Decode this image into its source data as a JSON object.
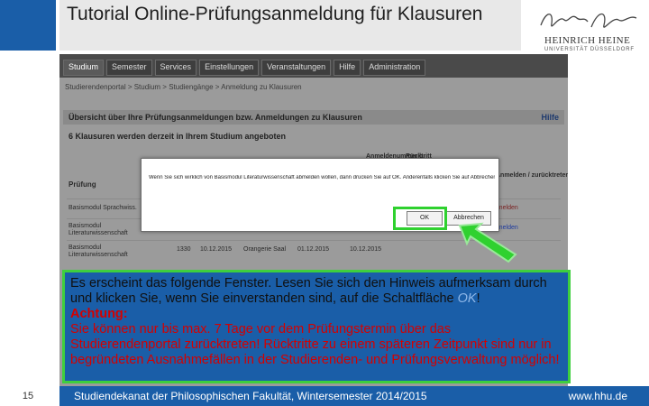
{
  "slide": {
    "title": "Tutorial Online-Prüfungsanmeldung für Klausuren",
    "page_number": "15",
    "footer_left": "Studiendekanat der Philosophischen Fakultät, Wintersemester 2014/2015",
    "footer_right": "www.hhu.de",
    "logo_name": "HEINRICH HEINE",
    "logo_sub": "UNIVERSITÄT DÜSSELDORF",
    "colors": {
      "brand_blue": "#1a5ea8",
      "highlight_green": "#3ecf3e",
      "attention_red": "#d40000"
    }
  },
  "portal": {
    "nav": [
      "Studium",
      "Semester",
      "Services",
      "Einstellungen",
      "Veranstaltungen",
      "Hilfe",
      "Administration"
    ],
    "breadcrumb": "Studierendenportal > Studium > Studiengänge > Anmeldung zu Klausuren",
    "panel_title": "Übersicht über Ihre Prüfungsanmeldungen bzw. Anmeldungen zu Klausuren",
    "help_label": "Hilfe",
    "count_line": "6 Klausuren werden derzeit in Ihrem Studium angeboten",
    "columns": {
      "pruefung": "Prüfung",
      "nummer": "Anmeldenummer b.",
      "rueckt": "Rücktritt",
      "anmelden": "Anmelden / zurücktreten"
    },
    "rows": [
      {
        "name": "Basismodul Sprachwiss.",
        "link": "anmelden"
      },
      {
        "name": "Basismodul Literaturwissenschaft",
        "link": "anmelden"
      },
      {
        "name": "Basismodul Literaturwissenschaft",
        "num": "1330",
        "date1": "10.12.2015",
        "room": "Orangerie Saal",
        "date2": "01.12.2015",
        "date3": "10.12.2015"
      }
    ]
  },
  "modal": {
    "message": "Wenn Sie sich wirklich von Basismodul Literaturwissenschaft abmelden wollen, dann drücken Sie auf OK. Anderenfalls klicken Sie auf Abbrechen.",
    "ok_label": "OK",
    "cancel_label": "Abbrechen"
  },
  "callout": {
    "line1_before": "Es erscheint das folgende Fenster. Lesen Sie sich den Hinweis aufmerksam durch und klicken Sie, wenn Sie einverstanden sind, auf die Schaltfläche ",
    "ok_word": "OK",
    "line1_after": "!",
    "attention": "Achtung:",
    "warning": "Sie können nur bis max. 7 Tage vor dem Prüfungstermin über das Studierendenportal zurücktreten! Rücktritte zu einem späteren Zeitpunkt sind nur in begründeten Ausnahmefällen in der Studierenden- und Prüfungsverwaltung möglich!"
  }
}
